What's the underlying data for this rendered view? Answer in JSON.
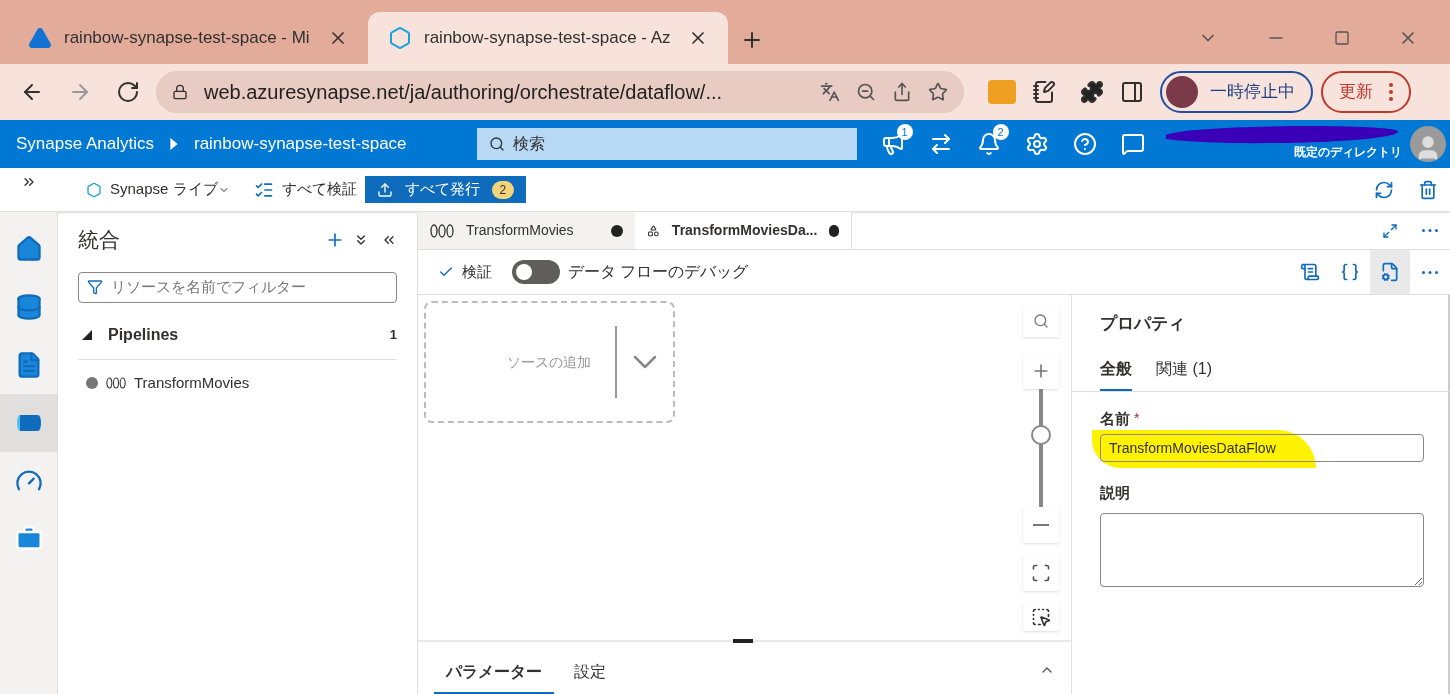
{
  "browser": {
    "tabs": [
      {
        "title": "rainbow-synapse-test-space - Mi",
        "kind": "azure",
        "selected": false
      },
      {
        "title": "rainbow-synapse-test-space - Az",
        "kind": "synapse",
        "selected": true
      }
    ],
    "url": "web.azuresynapse.net/ja/authoring/orchestrate/dataflow/...",
    "profile_label": "一時停止中",
    "update_button": "更新"
  },
  "header": {
    "app": "Synapse Analytics",
    "workspace": "rainbow-synapse-test-space",
    "search_placeholder": "検索",
    "announcement_badge": "1",
    "notification_badge": "2",
    "directory": "既定のディレクトリ"
  },
  "toolbar": {
    "library": "Synapse ライブ",
    "validate_all": "すべて検証",
    "publish_all": "すべて発行",
    "publish_count": "2"
  },
  "rail": [
    {
      "kind": "home",
      "selected": false
    },
    {
      "kind": "data",
      "selected": false
    },
    {
      "kind": "develop",
      "selected": false
    },
    {
      "kind": "integrate",
      "selected": true
    },
    {
      "kind": "monitor",
      "selected": false
    },
    {
      "kind": "manage",
      "selected": false
    }
  ],
  "panel": {
    "title": "統合",
    "filter_placeholder": "リソースを名前でフィルター",
    "section": {
      "label": "Pipelines",
      "count": "1",
      "expanded": true,
      "children": [
        {
          "label": "TransformMovies"
        }
      ]
    }
  },
  "doc_tabs": [
    {
      "label": "TransformMovies",
      "kind": "pipeline",
      "selected": false,
      "unsaved": true
    },
    {
      "label": "TransformMoviesDa...",
      "kind": "dataflow",
      "selected": true,
      "unsaved": true
    }
  ],
  "editor_toolbar": {
    "validate": "検証",
    "debug_label": "データ フローのデバッグ",
    "debug_on": false,
    "icons": [
      {
        "kind": "script",
        "selected": false
      },
      {
        "kind": "code",
        "selected": false
      },
      {
        "kind": "properties",
        "selected": true
      },
      {
        "kind": "more",
        "selected": false
      }
    ]
  },
  "canvas": {
    "add_source": "ソースの追加",
    "zoom": {
      "level": 0.63
    }
  },
  "bottom_tabs": [
    {
      "label": "パラメーター",
      "selected": true
    },
    {
      "label": "設定",
      "selected": false
    }
  ],
  "properties": {
    "title": "プロパティ",
    "tabs": [
      {
        "label": "全般",
        "selected": true
      },
      {
        "label": "関連 (1)",
        "selected": false
      }
    ],
    "name_label": "名前",
    "required_mark": "*",
    "name_value": "TransformMoviesDataFlow",
    "description_label": "説明"
  }
}
